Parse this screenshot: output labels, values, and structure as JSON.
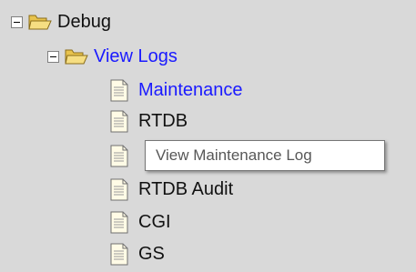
{
  "tree": {
    "root": {
      "label": "Debug",
      "icon": "open-folder-icon",
      "expanded": true,
      "children": [
        {
          "label": "View Logs",
          "icon": "open-folder-icon",
          "expanded": true,
          "children": [
            {
              "label": "Maintenance",
              "icon": "document-icon",
              "selected_link": true
            },
            {
              "label": "RTDB",
              "icon": "document-icon"
            },
            {
              "label": "",
              "icon": "document-icon"
            },
            {
              "label": "RTDB Audit",
              "icon": "document-icon"
            },
            {
              "label": "CGI",
              "icon": "document-icon"
            },
            {
              "label": "GS",
              "icon": "document-icon"
            }
          ]
        }
      ]
    }
  },
  "tooltip": {
    "text": "View Maintenance Log"
  },
  "colors": {
    "background": "#d9d9d9",
    "link_blue": "#1a1aff",
    "text": "#111111",
    "folder_yellow": "#f2d66b"
  }
}
